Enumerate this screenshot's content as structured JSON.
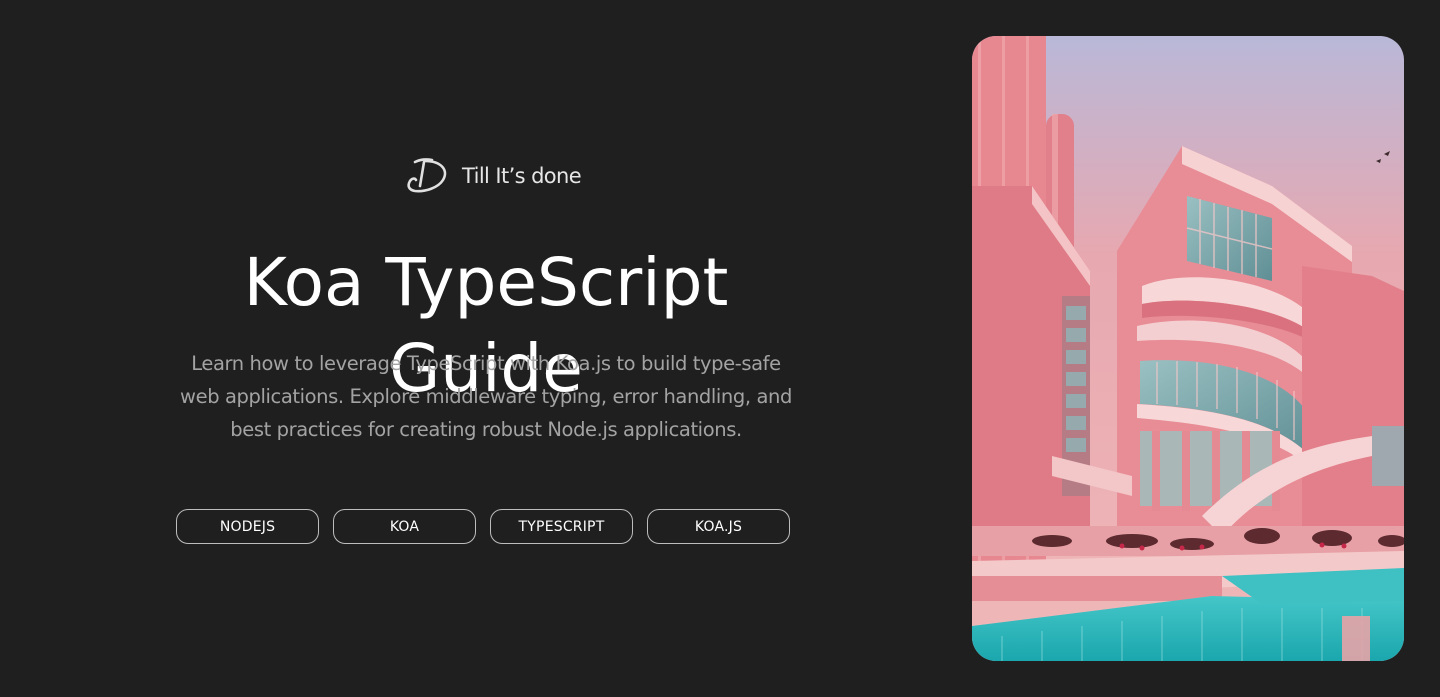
{
  "brand": {
    "name": "Till It’s done",
    "logo_icon": "d-monogram-icon"
  },
  "hero": {
    "title": "Koa TypeScript Guide",
    "description": "Learn how to leverage TypeScript with Koa.js to build type-safe web applications. Explore middleware typing, error handling, and best practices for creating robust Node.js applications."
  },
  "tags": [
    {
      "label": "NODEJS"
    },
    {
      "label": "KOA"
    },
    {
      "label": "TYPESCRIPT"
    },
    {
      "label": "KOA.JS"
    }
  ],
  "image": {
    "subject": "pink-modernist-building-with-pool-illustration",
    "colors": {
      "sky": "#d8a3a8",
      "building": "#e58a93",
      "building_light": "#f2c2c4",
      "glass": "#7fa9ad",
      "pool": "#2fb9bd"
    }
  },
  "colors": {
    "background": "#1f1f1f",
    "text": "#ffffff",
    "muted_text": "#a3a3a3",
    "tag_border": "#bdbdbd"
  }
}
